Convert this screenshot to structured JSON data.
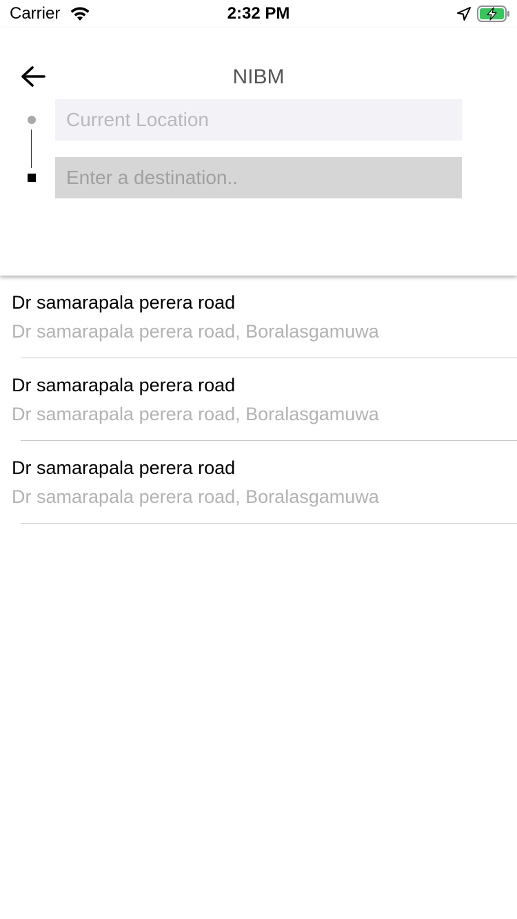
{
  "status_bar": {
    "carrier": "Carrier",
    "time": "2:32 PM",
    "icons": [
      "wifi-icon",
      "location-arrow-icon",
      "battery-charging-icon"
    ],
    "battery_color": "#34c759"
  },
  "header": {
    "title": "NIBM",
    "back_icon": "arrow-left-icon",
    "origin_placeholder": "Current Location",
    "destination_placeholder": "Enter a destination.."
  },
  "results": [
    {
      "title": "Dr samarapala perera road",
      "subtitle": "Dr samarapala perera road, Boralasgamuwa"
    },
    {
      "title": "Dr samarapala perera road",
      "subtitle": "Dr samarapala perera road, Boralasgamuwa"
    },
    {
      "title": "Dr samarapala perera road",
      "subtitle": "Dr samarapala perera road, Boralasgamuwa"
    }
  ]
}
